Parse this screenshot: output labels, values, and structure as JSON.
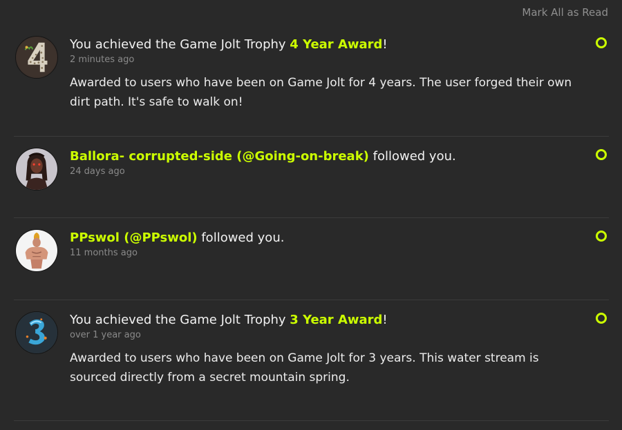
{
  "header": {
    "mark_all_label": "Mark All as Read"
  },
  "accent_color": "#ccff00",
  "notifications": [
    {
      "prefix": "You achieved the Game Jolt Trophy ",
      "highlight": "4 Year Award",
      "suffix": "!",
      "time": "2 minutes ago",
      "description": "Awarded to users who have been on Game Jolt for 4 years. The user forged their own dirt path. It's safe to walk on!",
      "avatar_icon": "four-year-trophy-icon"
    },
    {
      "prefix": "",
      "highlight": "Ballora- corrupted-side (@Going-on-break)",
      "suffix": " followed you.",
      "time": "24 days ago",
      "avatar_icon": "user-avatar"
    },
    {
      "prefix": "",
      "highlight": "PPswol (@PPswol)",
      "suffix": " followed you.",
      "time": "11 months ago",
      "avatar_icon": "user-avatar"
    },
    {
      "prefix": "You achieved the Game Jolt Trophy ",
      "highlight": "3 Year Award",
      "suffix": "!",
      "time": "over 1 year ago",
      "description": "Awarded to users who have been on Game Jolt for 3 years. This water stream is sourced directly from a secret mountain spring.",
      "avatar_icon": "three-year-trophy-icon"
    }
  ]
}
